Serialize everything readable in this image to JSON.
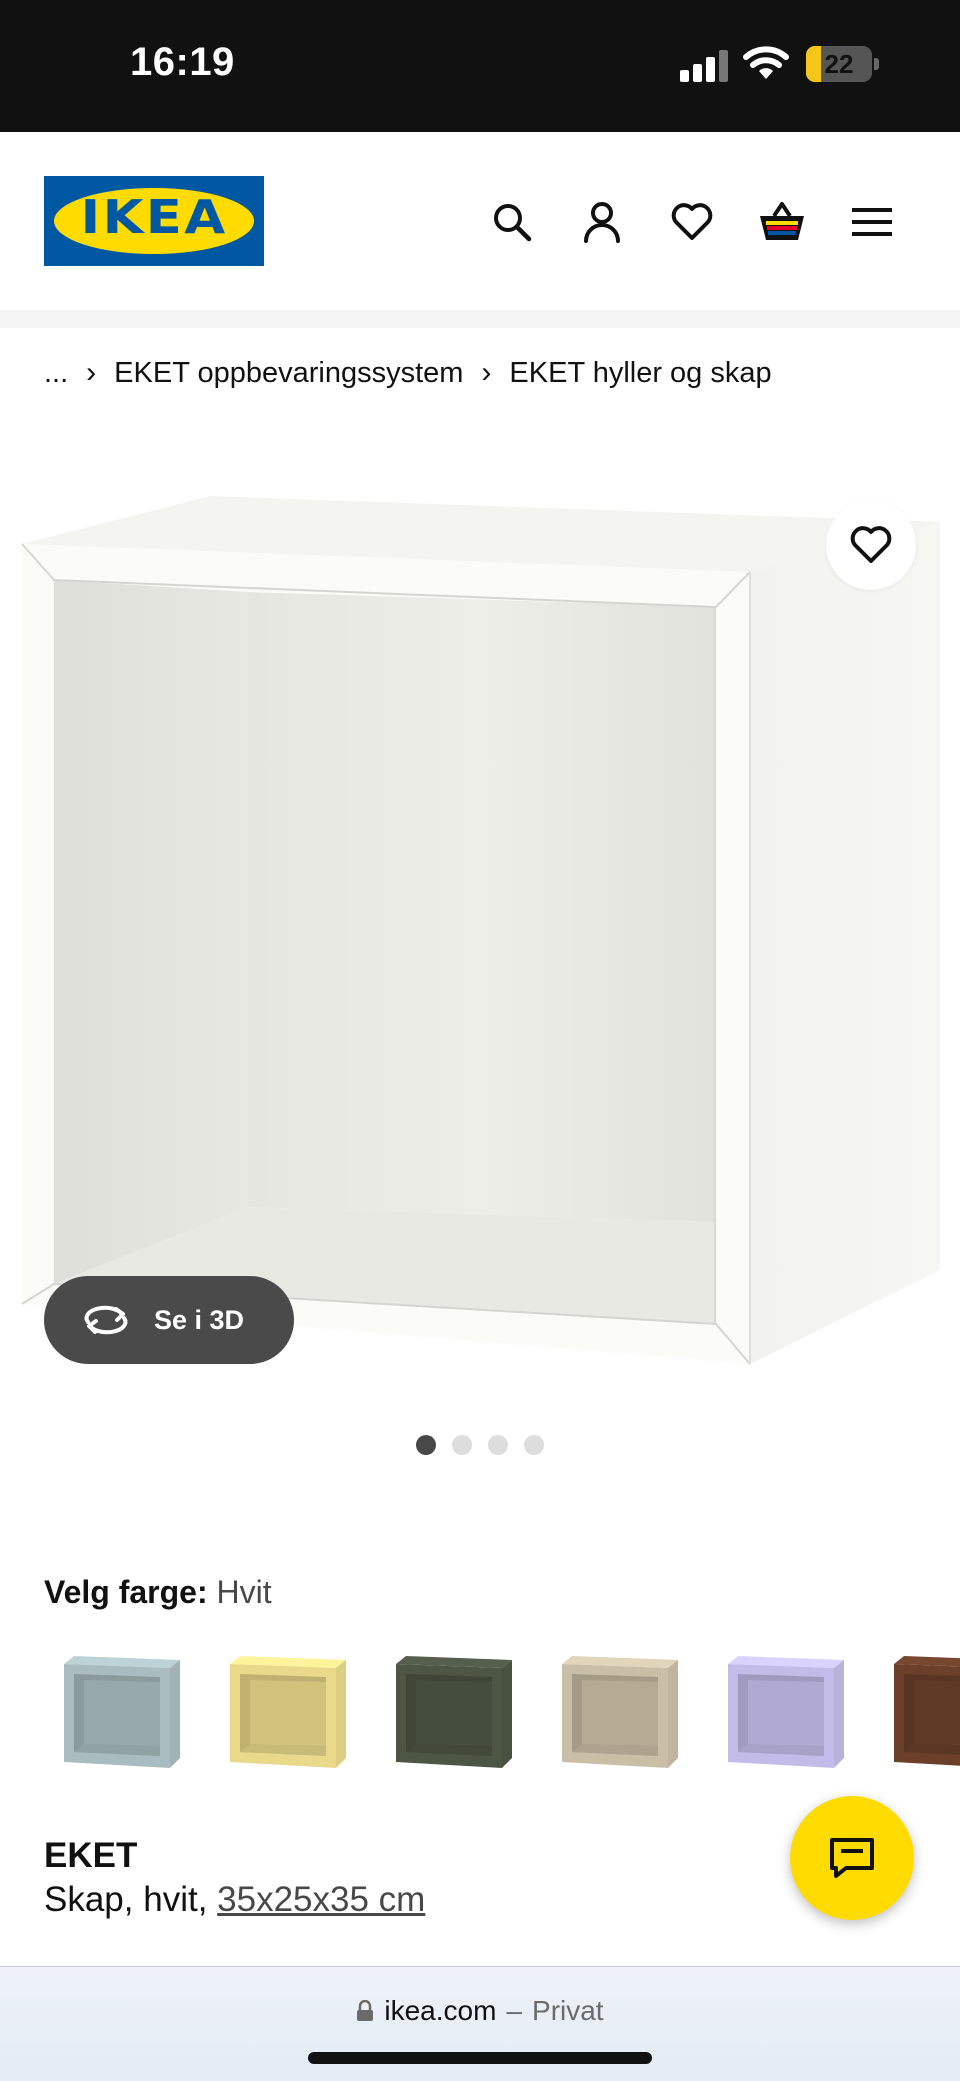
{
  "status_bar": {
    "time": "16:19",
    "battery": "22",
    "battery_level": 0.22,
    "icons": [
      "signal-icon",
      "wifi-icon",
      "battery-icon"
    ]
  },
  "header": {
    "logo_text": "IKEA",
    "icons": [
      "search-icon",
      "account-icon",
      "heart-icon",
      "cart-icon",
      "menu-icon"
    ],
    "colors": {
      "logo_blue": "#0058a3",
      "logo_yellow": "#ffdb00"
    }
  },
  "breadcrumb": {
    "items": [
      "...",
      "EKET oppbevaringssystem",
      "EKET hyller og skap"
    ]
  },
  "gallery": {
    "view_3d_label": "Se i 3D",
    "dot_count": 4,
    "active_dot": 0
  },
  "color_selector": {
    "label": "Velg farge:",
    "selected": "Hvit",
    "swatches": [
      {
        "name": "light-grey-blue",
        "color": "#a9bcc0"
      },
      {
        "name": "pale-yellow",
        "color": "#e9d98a"
      },
      {
        "name": "dark-grey-green",
        "color": "#4d5545"
      },
      {
        "name": "beige",
        "color": "#c9bea6"
      },
      {
        "name": "lilac",
        "color": "#c3bce8"
      },
      {
        "name": "walnut",
        "color": "#6b3f2a"
      }
    ]
  },
  "product": {
    "name": "EKET",
    "description_prefix": "Skap, hvit,",
    "size": "35x25x35 cm"
  },
  "browser": {
    "url": "ikea.com",
    "separator": "–",
    "mode": "Privat"
  }
}
